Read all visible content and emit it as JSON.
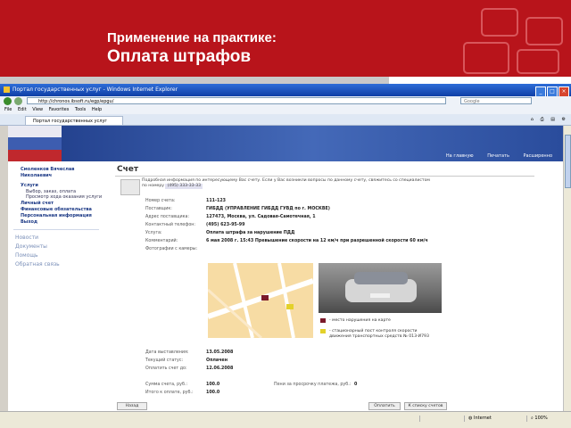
{
  "slide": {
    "subtitle": "Применение на практике:",
    "title": "Оплата штрафов"
  },
  "browser": {
    "window_title": "Портал государственных услуг - Windows Internet Explorer",
    "address": "http://chronos.ibsoft.ru/egp/epgu/",
    "search_placeholder": "Google",
    "menu": [
      "File",
      "Edit",
      "View",
      "Favorites",
      "Tools",
      "Help"
    ],
    "tab_label": "Портал государственных услуг",
    "status_zone": "Internet",
    "zoom": "100%"
  },
  "site": {
    "header_links": [
      "На главную",
      "Печатать",
      "Расширенно"
    ]
  },
  "sidebar": {
    "user_name": "Смоленков Вячеслав Николаевич",
    "services": "Услуги",
    "services_subs": [
      "Выбор, заказ, оплата",
      "Просмотр хода оказания услуги"
    ],
    "items": [
      "Личный счет",
      "Финансовые обязательства",
      "Персональная информация",
      "Выход"
    ],
    "links": [
      "Новости",
      "Документы",
      "Помощь",
      "Обратная связь"
    ]
  },
  "invoice": {
    "heading": "Счет",
    "info_text": "Подробная информация по интересующему Вас счету. Если у Вас возникли вопросы по данному счету, свяжитесь со специалистом по номеру",
    "info_phone": "(495) 333-33-33",
    "fields": [
      {
        "label": "Номер счета:",
        "value": "111-123"
      },
      {
        "label": "Поставщик:",
        "value": "ГИБДД (УПРАВЛЕНИЕ ГИБДД ГУВД по г. МОСКВЕ)"
      },
      {
        "label": "Адрес поставщика:",
        "value": "127473, Москва, ул. Садовая-Самотечная, 1"
      },
      {
        "label": "Контактный телефон:",
        "value": "(495) 623-95-99"
      },
      {
        "label": "Услуга:",
        "value": "Оплата штрафа за нарушение ПДД"
      },
      {
        "label": "Комментарий:",
        "value": "6 мая 2008 г. 15:43 Превышение скорости на 12 км/ч при разрешенной скорости 60 км/ч"
      },
      {
        "label": "Фотографии с камеры:",
        "value": ""
      }
    ],
    "legend": [
      {
        "text": "- место нарушения на карте"
      },
      {
        "text": "- стационарный пост контроля скорости движения транспортных средств № 013-И793"
      }
    ],
    "dates": [
      {
        "label": "Дата выставления:",
        "value": "13.05.2008"
      },
      {
        "label": "Текущий статус:",
        "value": "Оплачен"
      },
      {
        "label": "Оплатить счет до:",
        "value": "12.06.2008"
      }
    ],
    "totals": [
      {
        "label": "Сумма счета, руб.:",
        "value": "100.0"
      },
      {
        "label": "Итого к оплате, руб.:",
        "value": "100.0"
      }
    ],
    "penalty_label": "Пени за просрочку платежа, руб.:",
    "penalty_value": "0",
    "buttons": {
      "back": "Назад",
      "pay": "Оплатить",
      "to_list": "К списку счетов"
    }
  },
  "colors": {
    "brand_red": "#b8141b",
    "site_blue": "#1d3a86"
  }
}
